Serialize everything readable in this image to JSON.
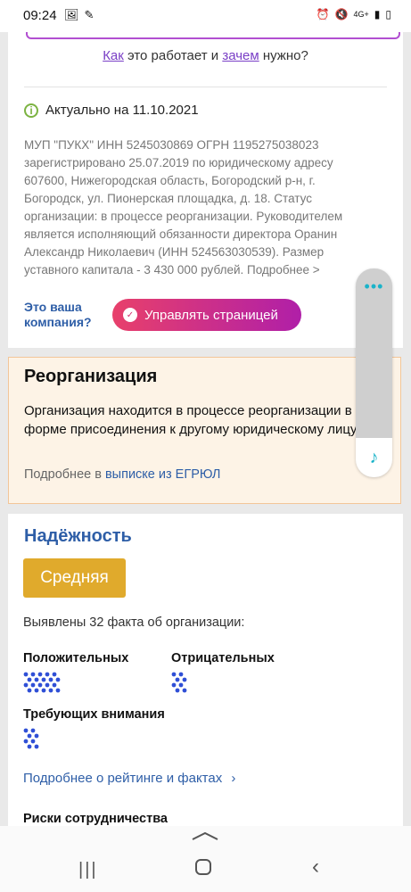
{
  "status_bar": {
    "time": "09:24",
    "left_icons": [
      "image-icon",
      "wand-icon"
    ],
    "right_icons": [
      "alarm-icon",
      "mute-icon",
      "lte-icon",
      "signal-icon",
      "battery-icon"
    ],
    "network": "4G+"
  },
  "how_it_works": {
    "link1": "Как",
    "middle": " это работает и ",
    "link2": "зачем",
    "end": " нужно?"
  },
  "company": {
    "actual_date": "Актуально на 11.10.2021",
    "description": "МУП \"ПУКХ\" ИНН 5245030869 ОГРН 1195275038023 зарегистрировано 25.07.2019 по юридическому адресу 607600, Нижегородская область, Богородский р-н, г. Богородск, ул. Пионерская площадка, д. 18. Статус организации: в процессе реорганизации. Руководителем является исполняющий обязанности директора Оранин Александр Николаевич (ИНН 524563030539). Размер уставного капитала - 3 430 000 рублей. Подробнее >",
    "own_line1": "Это ваша",
    "own_line2": "компания?",
    "manage_button": "Управлять страницей"
  },
  "reorganization": {
    "title": "Реорганизация",
    "text": "Организация находится в процессе реорганизации в форме присоединения к другому юридическому лицу.",
    "more_prefix": "Подробнее в ",
    "more_link": "выписке из ЕГРЮЛ"
  },
  "reliability": {
    "title": "Надёжность",
    "grade": "Средняя",
    "facts": "Выявлены 32 факта об организации:",
    "positive_label": "Положительных",
    "negative_label": "Отрицательных",
    "attention_label": "Требующих внимания",
    "more_link": "Подробнее о рейтинге и фактах",
    "risks": "Риски сотрудничества"
  },
  "colors": {
    "accent_blue": "#2e5ea7",
    "grade": "#e0aa2c",
    "button_start": "#e8406b",
    "button_end": "#b01fa8",
    "dots": "#2f4fd6"
  }
}
